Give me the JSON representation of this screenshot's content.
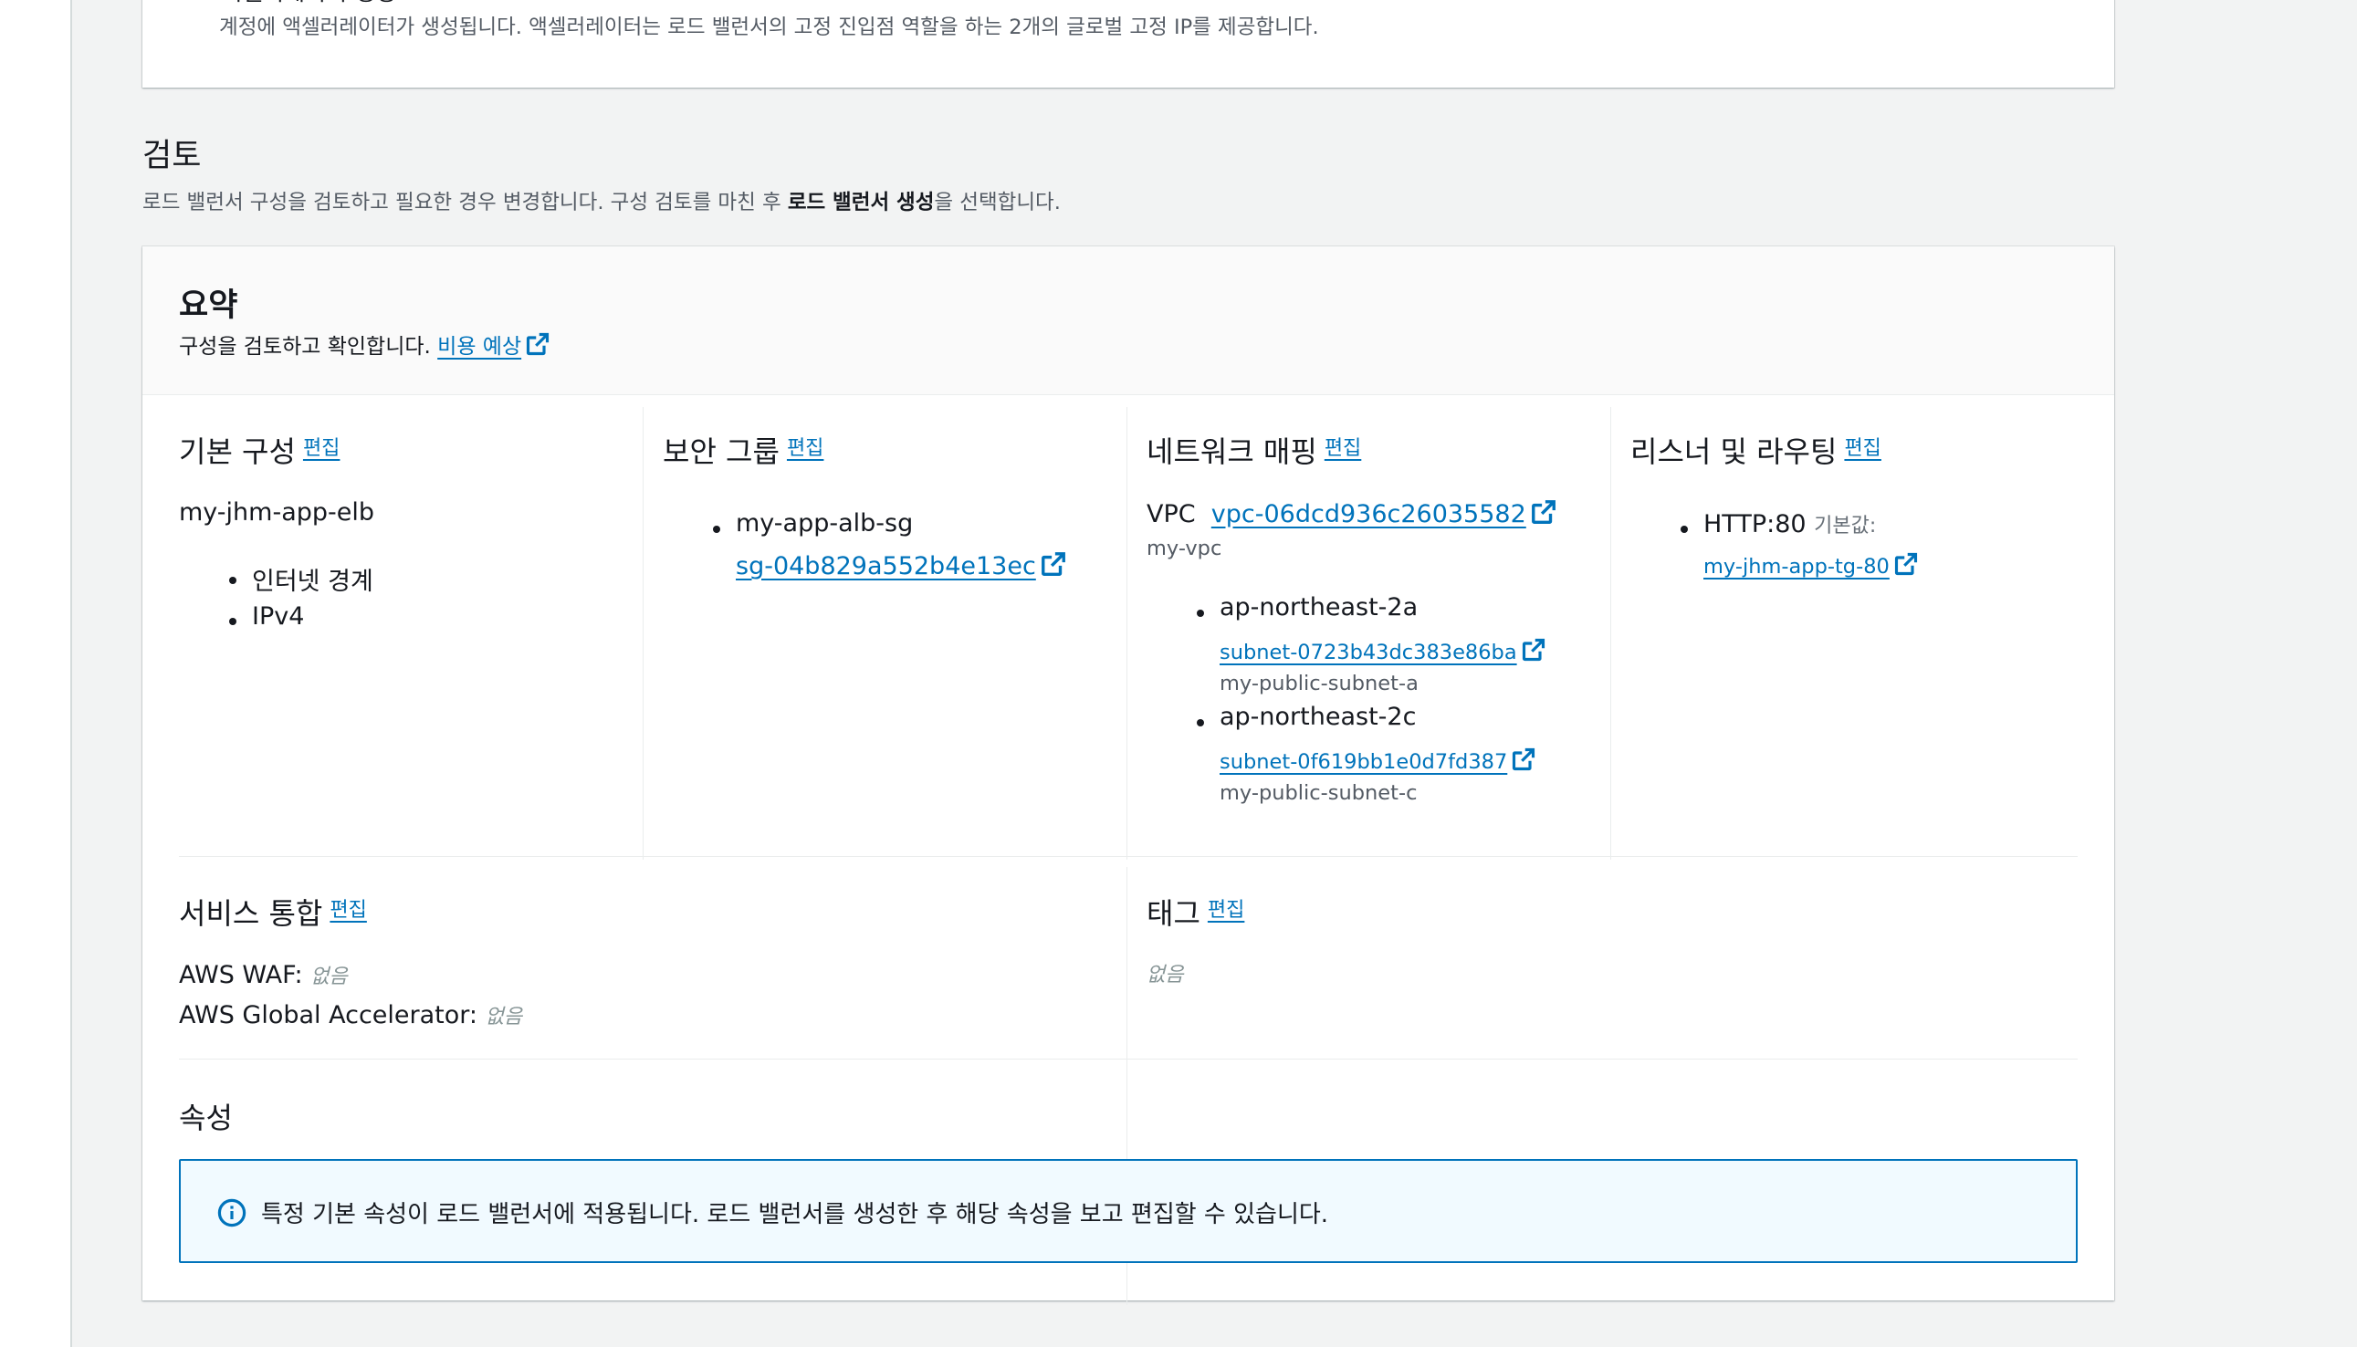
{
  "accelerator": {
    "checkbox_label": "액셀러레이터 생성",
    "description": "계정에 액셀러레이터가 생성됩니다. 액셀러레이터는 로드 밸런서의 고정 진입점 역할을 하는 2개의 글로벌 고정 IP를 제공합니다."
  },
  "review": {
    "title": "검토",
    "desc_before": "로드 밸런서 구성을 검토하고 필요한 경우 변경합니다. 구성 검토를 마친 후 ",
    "desc_bold": "로드 밸런서 생성",
    "desc_after": "을 선택합니다."
  },
  "summary": {
    "title": "요약",
    "desc": "구성을 검토하고 확인합니다.",
    "cost_link": "비용 예상"
  },
  "edit_label": "편집",
  "basic": {
    "title": "기본 구성",
    "name": "my-jhm-app-elb",
    "items": [
      "인터넷 경계",
      "IPv4"
    ]
  },
  "security": {
    "title": "보안 그룹",
    "group_name": "my-app-alb-sg",
    "group_id": "sg-04b829a552b4e13ec"
  },
  "network": {
    "title": "네트워크 매핑",
    "vpc_label": "VPC",
    "vpc_id": "vpc-06dcd936c26035582",
    "vpc_name": "my-vpc",
    "zones": [
      {
        "az": "ap-northeast-2a",
        "subnet": "subnet-0723b43dc383e86ba",
        "subnet_name": "my-public-subnet-a"
      },
      {
        "az": "ap-northeast-2c",
        "subnet": "subnet-0f619bb1e0d7fd387",
        "subnet_name": "my-public-subnet-c"
      }
    ]
  },
  "listener": {
    "title": "리스너 및 라우팅",
    "protocol": "HTTP:80",
    "default_label": "기본값:",
    "target_group": "my-jhm-app-tg-80"
  },
  "services": {
    "title": "서비스 통합",
    "waf_label": "AWS WAF:",
    "waf_value": "없음",
    "ga_label": "AWS Global Accelerator:",
    "ga_value": "없음"
  },
  "tags": {
    "title": "태그",
    "value": "없음"
  },
  "attributes": {
    "title": "속성",
    "info": "특정 기본 속성이 로드 밸런서에 적용됩니다. 로드 밸런서를 생성한 후 해당 속성을 보고 편집할 수 있습니다."
  },
  "colors": {
    "link": "#0073bb",
    "text": "#16191f",
    "muted": "#545b64",
    "info_bg": "#f1faff",
    "page_bg": "#f2f3f3"
  }
}
